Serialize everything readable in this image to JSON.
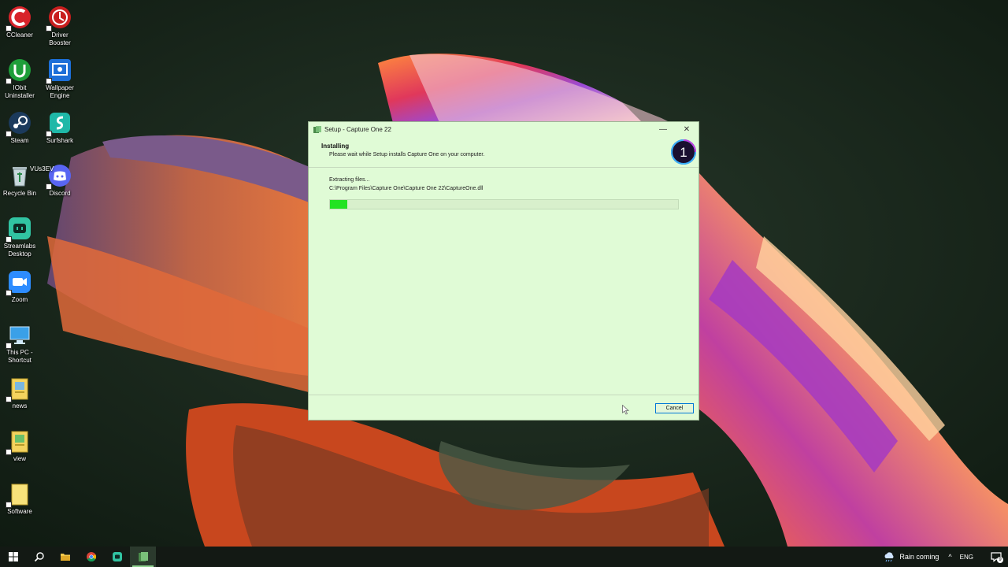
{
  "desktop": {
    "icons": [
      {
        "label": "CCleaner",
        "icon": "ccleaner-icon"
      },
      {
        "label": "Driver\nBooster",
        "icon": "driver-booster-icon"
      },
      {
        "label": "IObit\nUninstaller",
        "icon": "iobit-uninstaller-icon"
      },
      {
        "label": "Wallpaper\nEngine",
        "icon": "wallpaper-engine-icon"
      },
      {
        "label": "Steam",
        "icon": "steam-icon"
      },
      {
        "label": "Surfshark",
        "icon": "surfshark-icon"
      },
      {
        "label": "Recycle Bin",
        "icon": "recycle-bin-icon"
      },
      {
        "label": "Discord",
        "icon": "discord-icon"
      },
      {
        "label": "Streamlabs\nDesktop",
        "icon": "streamlabs-icon"
      },
      {
        "label": "Zoom",
        "icon": "zoom-icon"
      },
      {
        "label": "This PC -\nShortcut",
        "icon": "this-pc-icon"
      },
      {
        "label": "news",
        "icon": "folder-icon"
      },
      {
        "label": "view",
        "icon": "folder-icon"
      },
      {
        "label": "Software",
        "icon": "folder-icon"
      }
    ],
    "stray_label": "VUs3EV"
  },
  "setup": {
    "window_title": "Setup - Capture One 22",
    "minimize_glyph": "—",
    "close_glyph": "✕",
    "header_title": "Installing",
    "header_subtitle": "Please wait while Setup installs Capture One on your computer.",
    "logo_text": "1",
    "status": "Extracting files...",
    "file_path": "C:\\Program Files\\Capture One\\Capture One 22\\CaptureOne.dll",
    "progress": 0.05,
    "cancel_label": "Cancel"
  },
  "taskbar": {
    "items": [
      "windows-start-icon",
      "search-icon",
      "file-explorer-icon",
      "chrome-icon",
      "streamlabs-icon",
      "setup-app-icon"
    ],
    "active_index": 5,
    "weather_text": "Rain coming",
    "chevron": "^",
    "language": "ENG",
    "notification_count": "9"
  },
  "colors": {
    "window_bg": "#e0fbd6",
    "progress_fill": "#22e322",
    "accent": "#0078d7",
    "taskbar_bg": "#131914"
  }
}
